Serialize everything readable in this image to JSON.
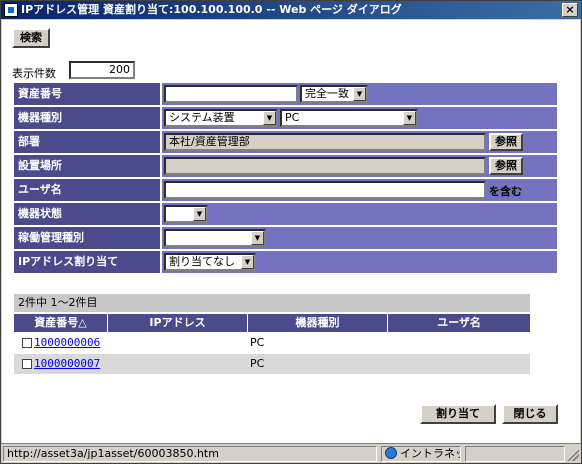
{
  "window": {
    "title": "IPアドレス管理 資産割り当て:100.100.100.0 -- Web ページ ダイアログ",
    "close": "×"
  },
  "toolbar": {
    "search_label": "検索"
  },
  "display_count": {
    "label": "表示件数",
    "value": "200"
  },
  "form": {
    "asset_no": {
      "label": "資産番号",
      "value": "",
      "match": "完全一致"
    },
    "device_type": {
      "label": "機器種別",
      "category": "システム装置",
      "type": "PC"
    },
    "department": {
      "label": "部署",
      "value": "本社/資産管理部",
      "browse": "参照"
    },
    "location": {
      "label": "設置場所",
      "value": "",
      "browse": "参照"
    },
    "user_name": {
      "label": "ユーザ名",
      "value": "",
      "suffix": "を含む"
    },
    "device_status": {
      "label": "機器状態",
      "value": ""
    },
    "operation_type": {
      "label": "稼働管理種別",
      "value": ""
    },
    "ip_assign": {
      "label": "IPアドレス割り当て",
      "value": "割り当てなし"
    }
  },
  "results": {
    "summary": "2件中 1～2件目",
    "columns": [
      "資産番号△",
      "IPアドレス",
      "機器種別",
      "ユーザ名"
    ],
    "rows": [
      {
        "asset_no": "1000000006",
        "ip": "",
        "type": "PC",
        "user": ""
      },
      {
        "asset_no": "1000000007",
        "ip": "",
        "type": "PC",
        "user": ""
      }
    ]
  },
  "actions": {
    "assign": "割り当て",
    "close": "閉じる"
  },
  "status": {
    "url": "http://asset3a/jp1asset/60003850.htm",
    "zone": "イントラネット"
  }
}
